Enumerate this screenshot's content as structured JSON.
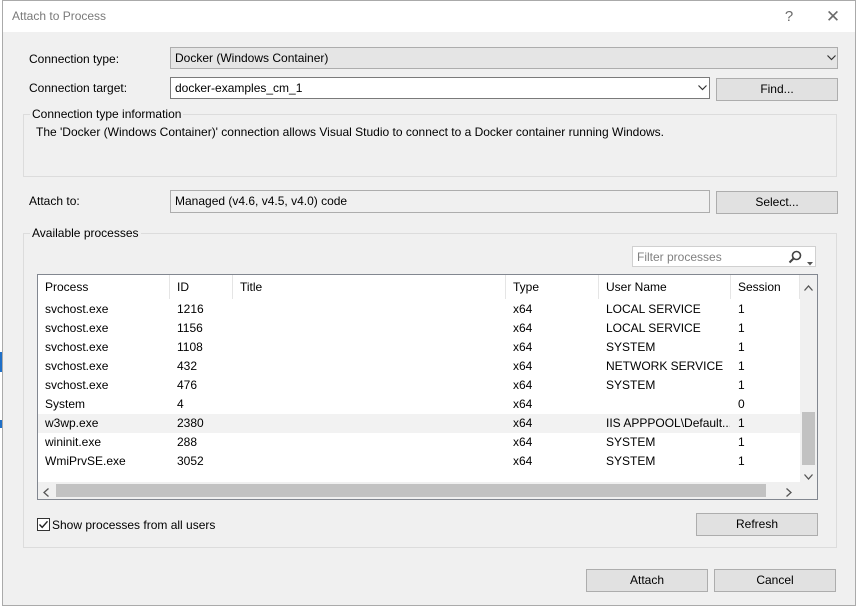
{
  "window": {
    "title": "Attach to Process",
    "help_label": "?",
    "close_label": "✕"
  },
  "connection": {
    "type_label": "Connection type:",
    "type_value": "Docker (Windows Container)",
    "target_label": "Connection target:",
    "target_value": "docker-examples_cm_1",
    "find_button": "Find...",
    "info_title": "Connection type information",
    "info_text": "The 'Docker (Windows Container)' connection allows Visual Studio to connect to a Docker container running Windows."
  },
  "attach_to": {
    "label": "Attach to:",
    "value": "Managed (v4.6, v4.5, v4.0) code",
    "select_button": "Select..."
  },
  "processes": {
    "group_title": "Available processes",
    "filter_placeholder": "Filter processes",
    "columns": [
      "Process",
      "ID",
      "Title",
      "Type",
      "User Name",
      "Session"
    ],
    "rows": [
      [
        "svchost.exe",
        "1216",
        "",
        "x64",
        "LOCAL SERVICE",
        "1"
      ],
      [
        "svchost.exe",
        "1156",
        "",
        "x64",
        "LOCAL SERVICE",
        "1"
      ],
      [
        "svchost.exe",
        "1108",
        "",
        "x64",
        "SYSTEM",
        "1"
      ],
      [
        "svchost.exe",
        "432",
        "",
        "x64",
        "NETWORK SERVICE",
        "1"
      ],
      [
        "svchost.exe",
        "476",
        "",
        "x64",
        "SYSTEM",
        "1"
      ],
      [
        "System",
        "4",
        "",
        "x64",
        "",
        "0"
      ],
      [
        "w3wp.exe",
        "2380",
        "",
        "x64",
        "IIS APPPOOL\\Default...",
        "1"
      ],
      [
        "wininit.exe",
        "288",
        "",
        "x64",
        "SYSTEM",
        "1"
      ],
      [
        "WmiPrvSE.exe",
        "3052",
        "",
        "x64",
        "SYSTEM",
        "1"
      ]
    ],
    "selected_row": 6,
    "show_all_label": "Show processes from all users",
    "show_all_checked": true,
    "refresh_button": "Refresh"
  },
  "footer": {
    "attach_button": "Attach",
    "cancel_button": "Cancel"
  },
  "colors": {
    "accent": "#1e6fc7",
    "dialog_bg": "#f0f0f0",
    "button_bg": "#e1e1e1"
  },
  "icons": [
    "help-icon",
    "close-icon",
    "chevron-down-icon",
    "search-icon",
    "checkmark-icon",
    "scroll-arrow-icon"
  ]
}
